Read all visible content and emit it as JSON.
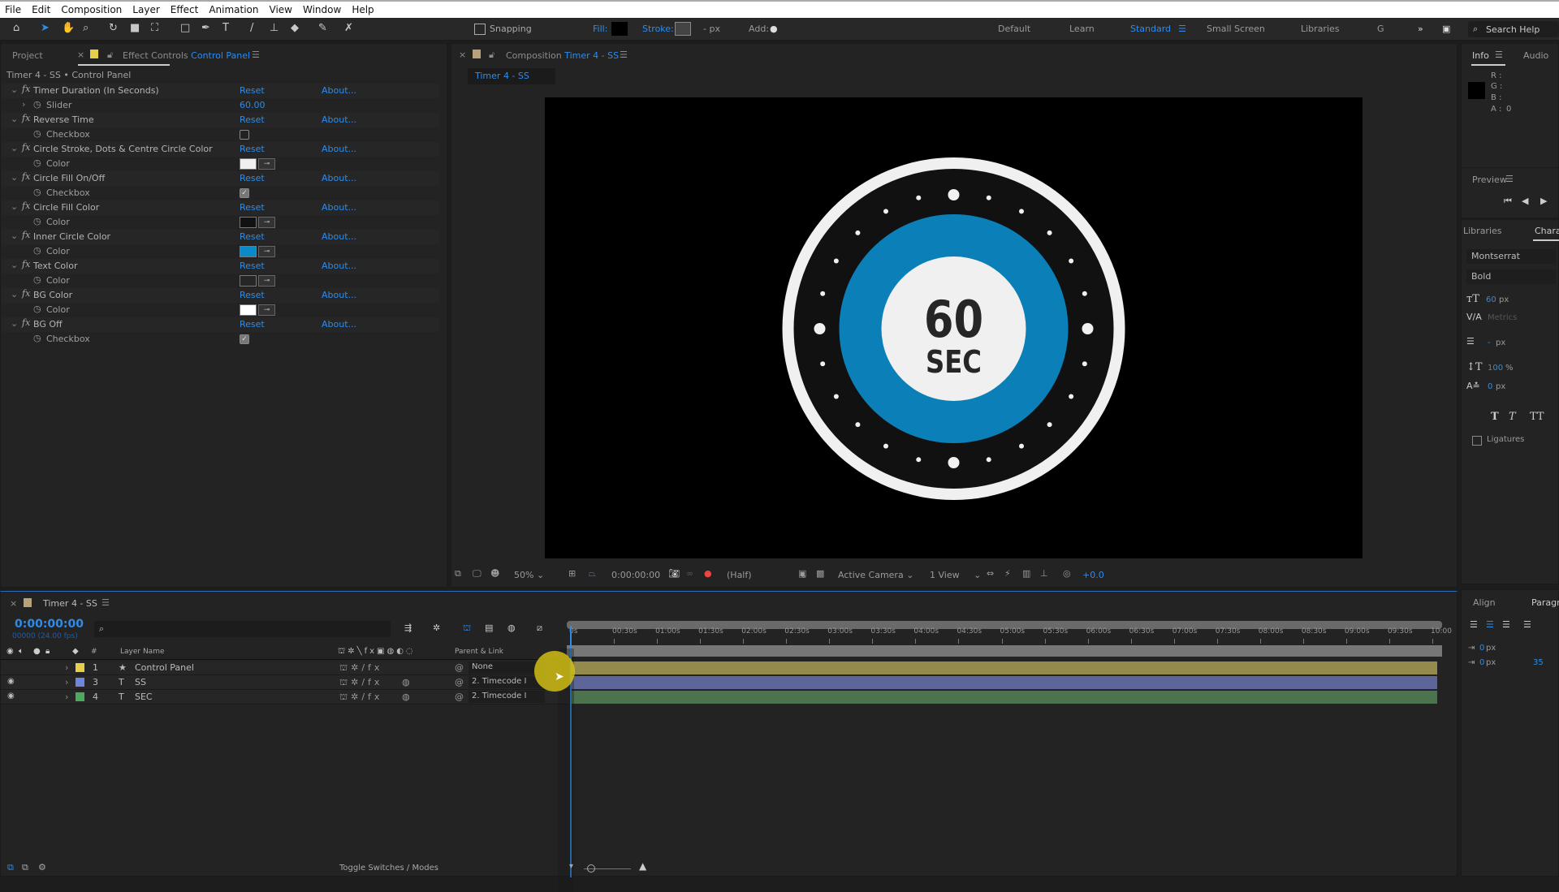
{
  "menu": [
    "File",
    "Edit",
    "Composition",
    "Layer",
    "Effect",
    "Animation",
    "View",
    "Window",
    "Help"
  ],
  "toolbar": {
    "snapping_label": "Snapping",
    "fill_label": "Fill:",
    "stroke_label": "Stroke:",
    "stroke_px": "- px",
    "add_label": "Add:",
    "workspaces": [
      "Default",
      "Learn",
      "Standard",
      "Small Screen",
      "Libraries",
      "G"
    ],
    "active_workspace": "Standard",
    "search_help": "Search Help"
  },
  "effect_controls": {
    "project_tab": "Project",
    "tab_prefix": "Effect Controls",
    "tab_layer": "Control Panel",
    "header": "Timer 4 - SS • Control Panel",
    "reset": "Reset",
    "about": "About...",
    "effects": [
      {
        "name": "Timer Duration (In Seconds)",
        "prop": "Slider",
        "type": "slider",
        "value": "60.00"
      },
      {
        "name": "Reverse Time",
        "prop": "Checkbox",
        "type": "checkbox",
        "checked": false
      },
      {
        "name": "Circle Stroke, Dots & Centre Circle Color",
        "prop": "Color",
        "type": "color",
        "color": "#f0f0f0"
      },
      {
        "name": "Circle Fill On/Off",
        "prop": "Checkbox",
        "type": "checkbox",
        "checked": true
      },
      {
        "name": "Circle Fill Color",
        "prop": "Color",
        "type": "color",
        "color": "#111111"
      },
      {
        "name": "Inner Circle Color",
        "prop": "Color",
        "type": "color",
        "color": "#0a8ac8"
      },
      {
        "name": "Text Color",
        "prop": "Color",
        "type": "color",
        "color": "#262626"
      },
      {
        "name": "BG Color",
        "prop": "Color",
        "type": "color",
        "color": "#ffffff"
      },
      {
        "name": "BG Off",
        "prop": "Checkbox",
        "type": "checkbox",
        "checked": true
      }
    ]
  },
  "composition": {
    "tab_prefix": "Composition",
    "tab_name": "Timer 4 - SS",
    "breadcrumb": "Timer 4 - SS",
    "timer_number": "60",
    "timer_unit": "SEC",
    "colors": {
      "ring": "#f0f0f0",
      "fill": "#111111",
      "inner": "#0a7fb8",
      "center": "#f0f0f0",
      "text": "#262626"
    },
    "viewer": {
      "zoom": "50%",
      "timecode": "0:00:00:00",
      "resolution": "(Half)",
      "camera": "Active Camera",
      "views": "1 View",
      "exposure": "+0.0"
    }
  },
  "info": {
    "tab": "Info",
    "audio_tab": "Audio",
    "r": "R :",
    "g": "G :",
    "b": "B :",
    "a": "A :",
    "a_value": "0"
  },
  "preview": {
    "title": "Preview"
  },
  "character": {
    "libraries_tab": "Libraries",
    "tab": "Chara",
    "font": "Montserrat",
    "style": "Bold",
    "size": "60",
    "size_unit": "px",
    "kerning": "Metrics",
    "leading": "-",
    "leading_unit": "px",
    "vscale": "100",
    "vscale_unit": "%",
    "baseline": "0",
    "baseline_unit": "px",
    "ligatures": "Ligatures"
  },
  "paragraph": {
    "align_tab": "Align",
    "tab": "Paragr",
    "indent1": "0",
    "indent2": "0",
    "unit": "px",
    "space": "35"
  },
  "timeline": {
    "tab": "Timer 4 - SS",
    "timecode": "0:00:00:00",
    "frames": "00000 (24.00 fps)",
    "col_layer_name": "Layer Name",
    "col_num": "#",
    "col_parent": "Parent & Link",
    "layers": [
      {
        "num": "1",
        "type": "★",
        "name": "Control Panel",
        "label": "#e8cf4a",
        "parent": "None",
        "bar": "#948a4c"
      },
      {
        "num": "3",
        "type": "T",
        "name": "SS",
        "label": "#6f86e0",
        "parent": "2. Timecode I",
        "bar": "#5c6698"
      },
      {
        "num": "4",
        "type": "T",
        "name": "SEC",
        "label": "#4caa5c",
        "parent": "2. Timecode I",
        "bar": "#4a734e"
      }
    ],
    "ruler": [
      "0s",
      "00:30s",
      "01:00s",
      "01:30s",
      "02:00s",
      "02:30s",
      "03:00s",
      "03:30s",
      "04:00s",
      "04:30s",
      "05:00s",
      "05:30s",
      "06:00s",
      "06:30s",
      "07:00s",
      "07:30s",
      "08:00s",
      "08:30s",
      "09:00s",
      "09:30s",
      "10:00"
    ],
    "toggle_label": "Toggle Switches / Modes"
  }
}
